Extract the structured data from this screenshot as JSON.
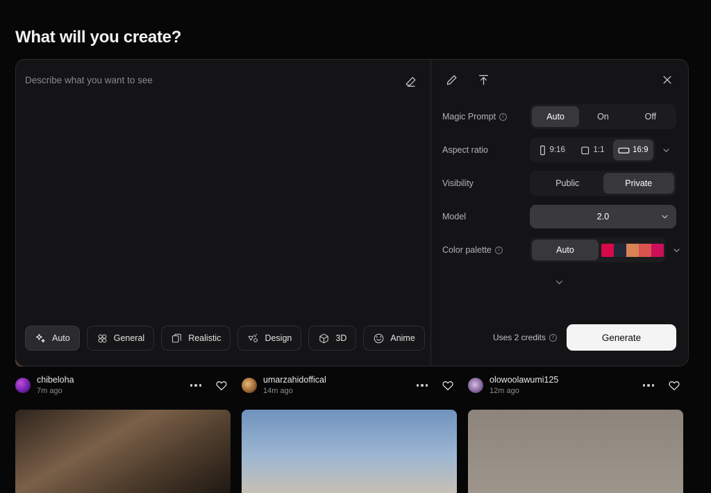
{
  "page": {
    "title": "What will you create?"
  },
  "prompt": {
    "placeholder": "Describe what you want to see",
    "eraser_icon": "eraser-icon"
  },
  "styles": {
    "chips": [
      {
        "label": "Auto",
        "icon": "sparkle-icon",
        "selected": true
      },
      {
        "label": "General",
        "icon": "clover-icon",
        "selected": false
      },
      {
        "label": "Realistic",
        "icon": "photos-stack-icon",
        "selected": false
      },
      {
        "label": "Design",
        "icon": "design-icon",
        "selected": false
      },
      {
        "label": "3D",
        "icon": "cube-icon",
        "selected": false
      },
      {
        "label": "Anime",
        "icon": "smiley-icon",
        "selected": false
      }
    ]
  },
  "settings": {
    "header_icons": [
      "pencil-icon",
      "upload-icon",
      "close-icon"
    ],
    "magic_prompt": {
      "label": "Magic Prompt",
      "options": [
        "Auto",
        "On",
        "Off"
      ],
      "selected": "Auto"
    },
    "aspect_ratio": {
      "label": "Aspect ratio",
      "options": [
        "9:16",
        "1:1",
        "16:9"
      ],
      "selected": "16:9"
    },
    "visibility": {
      "label": "Visibility",
      "options": [
        "Public",
        "Private"
      ],
      "selected": "Private"
    },
    "model": {
      "label": "Model",
      "value": "2.0"
    },
    "color_palette": {
      "label": "Color palette",
      "auto_label": "Auto",
      "selected": "Auto",
      "swatches": [
        "#d60a4a",
        "#232838",
        "#d98355",
        "#d9534f",
        "#cc0f5a"
      ]
    },
    "footer": {
      "credits_text": "Uses 2 credits",
      "generate_label": "Generate"
    }
  },
  "feed": {
    "posts": [
      {
        "user": "chibeloha",
        "time": "7m ago"
      },
      {
        "user": "umarzahidoffical",
        "time": "14m ago"
      },
      {
        "user": "olowoolawumi125",
        "time": "12m ago"
      }
    ]
  }
}
